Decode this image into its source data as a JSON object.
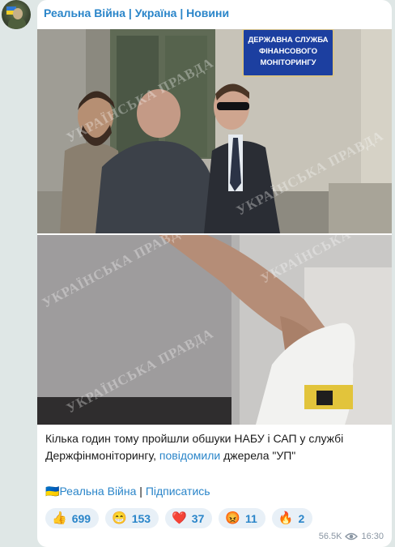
{
  "channel": {
    "name": "Реальна Війна | Україна | Новини"
  },
  "post": {
    "text_part1": "Кілька годин тому пройшли обшуки НАБУ і САП у службі Держфінмоніторингу,",
    "link_text": "повідомили",
    "text_part2": "джерела \"УП\"",
    "footer_flag": "🇺🇦",
    "footer_channel": "Реальна Війна",
    "footer_sep": "|",
    "footer_subscribe": "Підписатись",
    "sign_lines": [
      "ДЕРЖАВНА СЛУЖБА",
      "ФІНАНСОВОГО",
      "МОНІТОРИНГУ"
    ],
    "watermark": "УКРАЇНСЬКА ПРАВДА"
  },
  "reactions": [
    {
      "emoji": "👍",
      "count": "699",
      "icon": "thumbs-up-icon"
    },
    {
      "emoji": "😁",
      "count": "153",
      "icon": "grin-icon"
    },
    {
      "emoji": "❤️",
      "count": "37",
      "icon": "heart-icon"
    },
    {
      "emoji": "😡",
      "count": "11",
      "icon": "angry-face-icon"
    },
    {
      "emoji": "🔥",
      "count": "2",
      "icon": "fire-icon"
    }
  ],
  "meta": {
    "views": "56.5K",
    "time": "16:30"
  }
}
